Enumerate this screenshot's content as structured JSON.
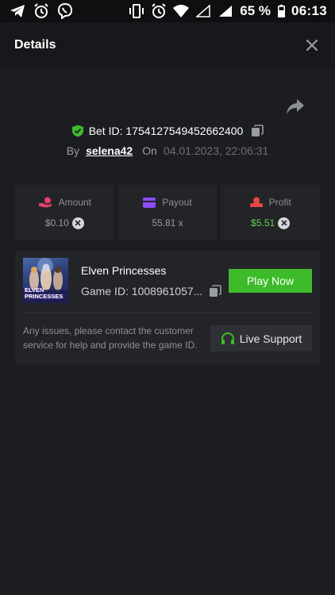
{
  "status_bar": {
    "battery_percent": "65 %",
    "time": "06:13"
  },
  "header": {
    "title": "Details"
  },
  "bet": {
    "id_text": "Bet ID: 1754127549452662400",
    "by_label": "By",
    "username": "selena42",
    "on_label": "On",
    "date": "04.01.2023, 22:06:31"
  },
  "stats": {
    "amount": {
      "label": "Amount",
      "value": "$0.10"
    },
    "payout": {
      "label": "Payout",
      "value": "55.81 x"
    },
    "profit": {
      "label": "Profit",
      "value": "$5.51"
    }
  },
  "game": {
    "thumb_text_line1": "ELVEN",
    "thumb_text_line2": "PRINCESSES",
    "name": "Elven Princesses",
    "id_text": "Game ID: 1008961057...",
    "play_label": "Play Now",
    "issue_text": "Any issues, please contact the customer service for help and provide the game ID.",
    "support_label": "Live Support"
  },
  "colors": {
    "background": "#1c1d21",
    "card": "#232428",
    "accent_green": "#3dbb2a",
    "profit_green": "#5fd14b",
    "amount_icon": "#e8406a",
    "payout_icon": "#8a4dff",
    "profit_icon": "#e84545",
    "shield": "#3dbb2a"
  },
  "icons": {
    "telegram": "telegram-icon",
    "alarm": "alarm-icon",
    "viber": "viber-icon",
    "vibrate": "vibrate-icon",
    "wifi": "wifi-icon",
    "signal": "signal-icon",
    "battery": "battery-icon",
    "close": "close-icon",
    "share": "share-icon",
    "shield": "shield-check-icon",
    "copy": "copy-icon",
    "headset": "headset-icon"
  }
}
